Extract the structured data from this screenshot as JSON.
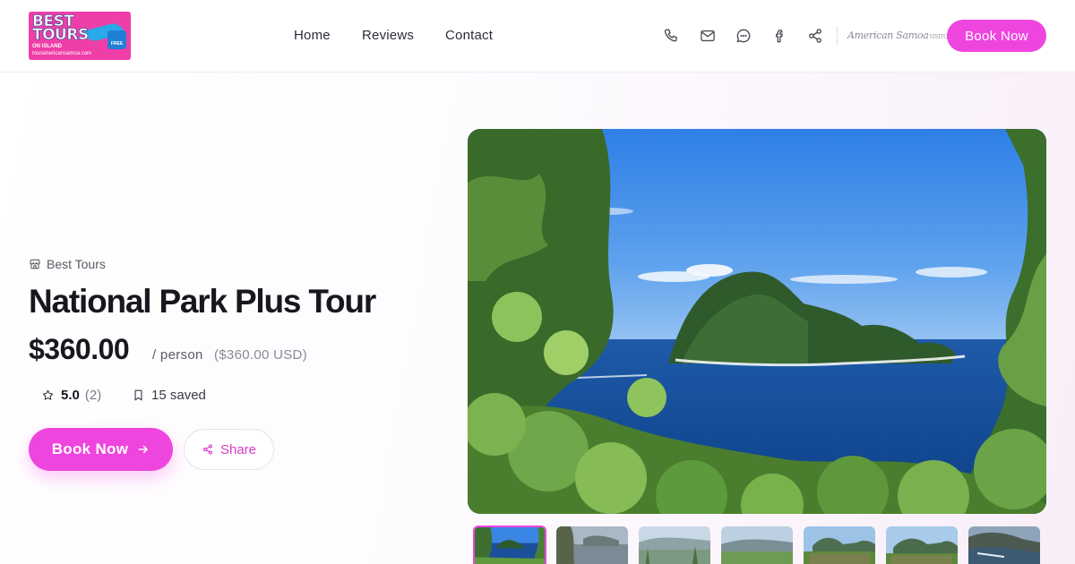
{
  "brand": {
    "logo_line1": "BEST",
    "logo_line2": "TOURS",
    "logo_line3": "ON ISLAND",
    "logo_line4": "touramericansamoa.com",
    "logo_badge": "FREE",
    "accent_color": "#ef45df"
  },
  "nav": {
    "home": "Home",
    "reviews": "Reviews",
    "contact": "Contact"
  },
  "header_icons": [
    "phone-icon",
    "mail-icon",
    "chat-icon",
    "facebook-icon",
    "share-icon"
  ],
  "partner_logo": {
    "text": "American Samoa",
    "small": "VISITOR BUREAU"
  },
  "header_cta": "Book Now",
  "tour": {
    "operator": "Best Tours",
    "title": "National Park Plus Tour",
    "price": "$360.00",
    "per": "/ person",
    "usd": "($360.00 USD)",
    "rating": "5.0",
    "rating_count": "(2)",
    "saved": "15 saved"
  },
  "actions": {
    "book": "Book Now",
    "share": "Share"
  },
  "gallery": {
    "thumb_count": 7,
    "active_index": 0
  }
}
